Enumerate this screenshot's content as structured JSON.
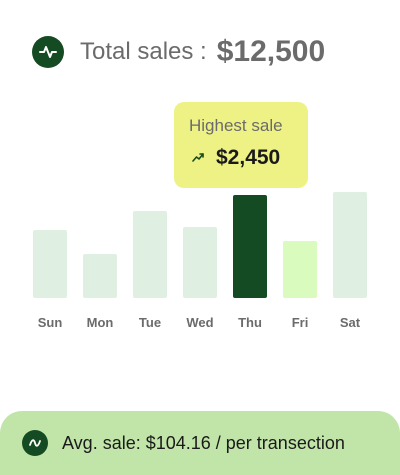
{
  "header": {
    "label": "Total sales :",
    "value": "$12,500",
    "icon": "activity-pulse-icon"
  },
  "tooltip": {
    "title": "Highest sale",
    "value": "$2,450",
    "icon": "trending-up-icon"
  },
  "colors": {
    "dark_green": "#154b22",
    "light_bar": "#dff0e2",
    "highlight_bar": "#d9fbbd",
    "tooltip_bg": "#eef285",
    "footer_bg": "#c1e5a9",
    "label_text": "#6b6b6b"
  },
  "chart_data": {
    "type": "bar",
    "categories": [
      "Sun",
      "Mon",
      "Tue",
      "Wed",
      "Thu",
      "Fri",
      "Sat"
    ],
    "values": [
      1620,
      1050,
      2080,
      1680,
      2450,
      1350,
      2520
    ],
    "highlight_index": 4,
    "secondary_index": 5,
    "ylim": [
      0,
      2520
    ],
    "grid": false
  },
  "footer": {
    "text": "Avg. sale: $104.16 / per transection",
    "icon": "wave-icon"
  }
}
